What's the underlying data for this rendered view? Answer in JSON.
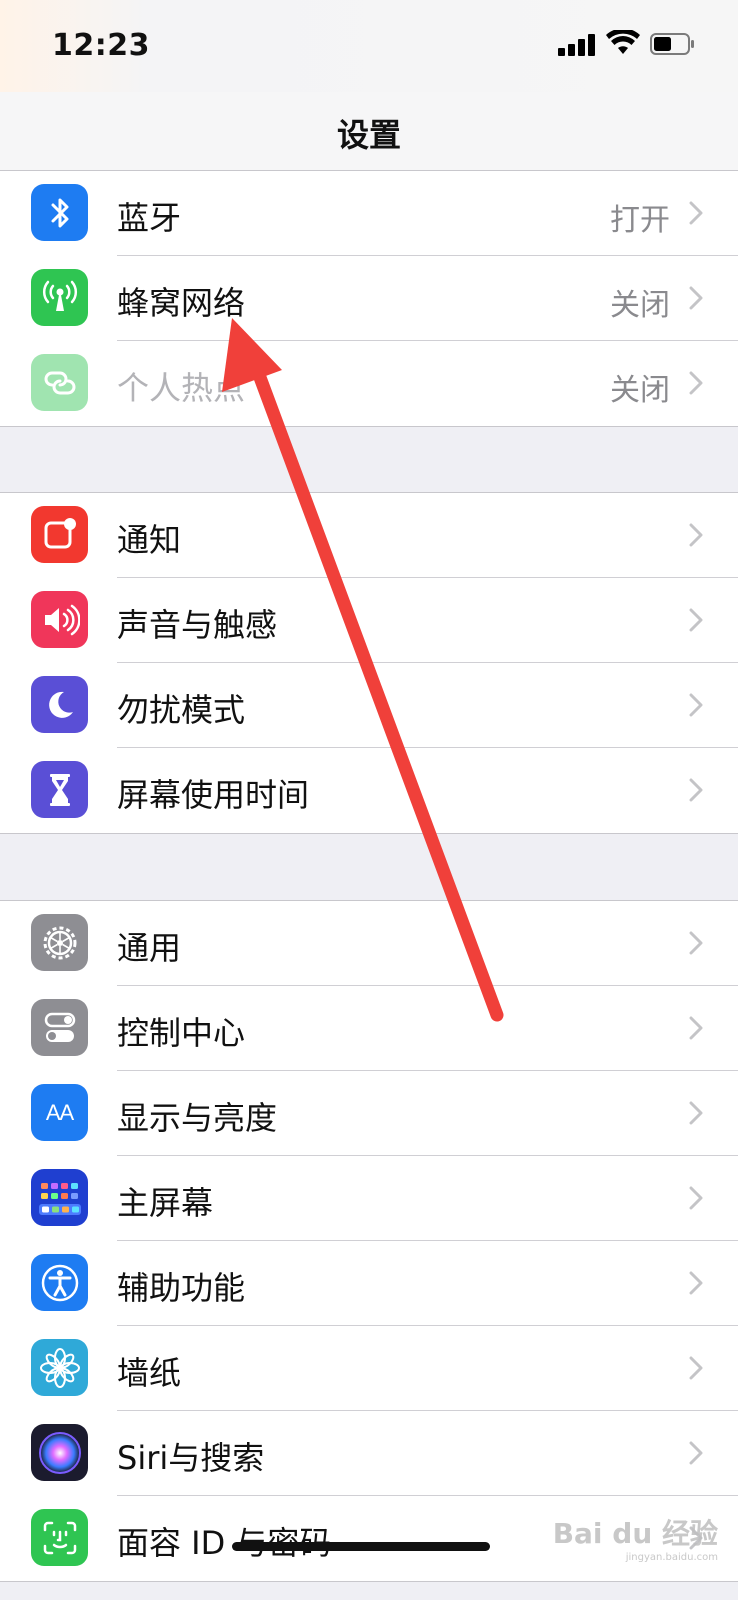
{
  "status_bar": {
    "time": "12:23"
  },
  "nav": {
    "title": "设置"
  },
  "groups": [
    {
      "items": [
        {
          "label": "蓝牙",
          "value": "打开",
          "icon": "bluetooth-icon",
          "color": "#1e7cf2"
        },
        {
          "label": "蜂窝网络",
          "value": "关闭",
          "icon": "cellular-icon",
          "color": "#2fc552"
        },
        {
          "label": "个人热点",
          "value": "关闭",
          "icon": "hotspot-icon",
          "color": "#2fc552"
        }
      ]
    },
    {
      "items": [
        {
          "label": "通知",
          "icon": "notifications-icon",
          "color": "#f2382f"
        },
        {
          "label": "声音与触感",
          "icon": "sound-icon",
          "color": "#f0365a"
        },
        {
          "label": "勿扰模式",
          "icon": "moon-icon",
          "color": "#5a4fd6"
        },
        {
          "label": "屏幕使用时间",
          "icon": "hourglass-icon",
          "color": "#5a4fd6"
        }
      ]
    },
    {
      "items": [
        {
          "label": "通用",
          "icon": "gear-icon",
          "color": "#8e8e93"
        },
        {
          "label": "控制中心",
          "icon": "toggles-icon",
          "color": "#8e8e93"
        },
        {
          "label": "显示与亮度",
          "icon": "display-icon",
          "color": "#1e7cf2",
          "glyph": "AA"
        },
        {
          "label": "主屏幕",
          "icon": "home-screen-icon",
          "color": "#1f3fd0"
        },
        {
          "label": "辅助功能",
          "icon": "accessibility-icon",
          "color": "#1e7cf2"
        },
        {
          "label": "墙纸",
          "icon": "wallpaper-icon",
          "color": "#2fa9d8"
        },
        {
          "label": "Siri与搜索",
          "icon": "siri-icon",
          "color": "#1b1b2e"
        },
        {
          "label": "面容 ID 与密码",
          "icon": "face-id-icon",
          "color": "#2fc552"
        }
      ]
    }
  ],
  "watermark": {
    "brand": "Bai du 经验",
    "url": "jingyan.baidu.com"
  },
  "annotation": {
    "type": "red-arrow",
    "color": "#f0403a"
  }
}
